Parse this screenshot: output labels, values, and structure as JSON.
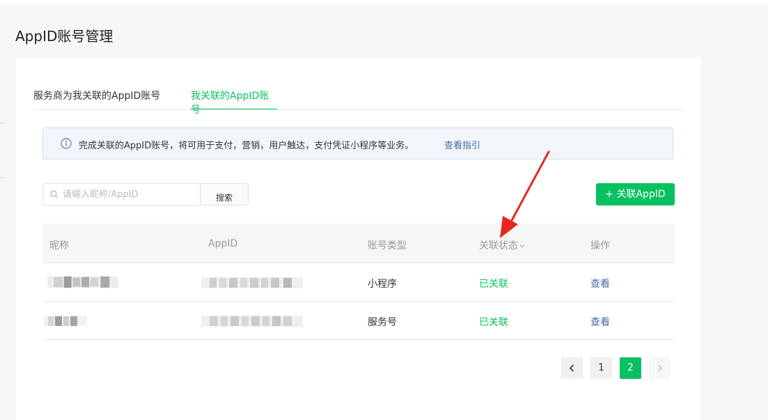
{
  "page": {
    "title": "AppID账号管理"
  },
  "tabs": [
    {
      "label": "服务商为我关联的AppID账号",
      "active": false
    },
    {
      "label": "我关联的AppID账号",
      "active": true
    }
  ],
  "notice": {
    "text": "完成关联的AppID账号，将可用于支付，营销，用户触达，支付凭证小程序等业务。",
    "link": "查看指引"
  },
  "search": {
    "placeholder": "请输入昵称/AppID",
    "button": "搜索"
  },
  "add_button": "+ 关联AppID",
  "table": {
    "headers": {
      "nickname": "昵称",
      "appid": "AppID",
      "type": "账号类型",
      "status": "关联状态",
      "action": "操作"
    },
    "rows": [
      {
        "type": "小程序",
        "status": "已关联",
        "action": "查看"
      },
      {
        "type": "服务号",
        "status": "已关联",
        "action": "查看"
      }
    ]
  },
  "pagination": {
    "pages": [
      "1",
      "2"
    ],
    "current": "2"
  },
  "colors": {
    "accent": "#07c160",
    "link": "#4a6aa8",
    "annotation_arrow": "#e5281f"
  },
  "icons": [
    "info-icon",
    "search-icon",
    "chevron-down-icon",
    "chevron-left-icon",
    "chevron-right-icon"
  ]
}
